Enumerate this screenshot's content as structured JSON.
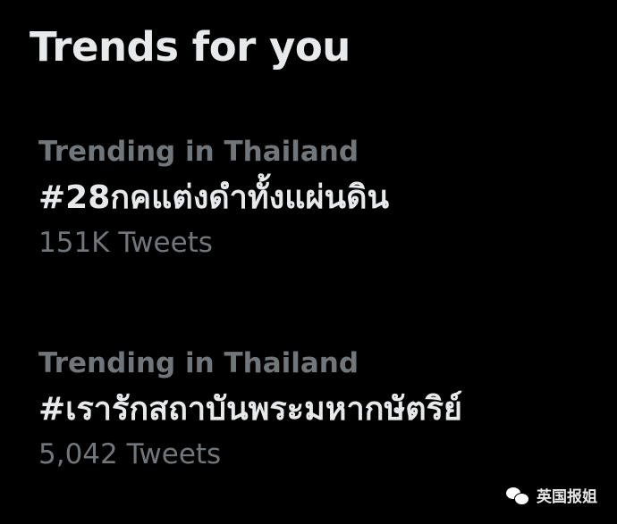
{
  "section": {
    "title": "Trends for you"
  },
  "trends": [
    {
      "context": "Trending in Thailand",
      "hashtag": "#28กคแต่งดำทั้งแผ่นดิน",
      "tweet_count": "151K Tweets"
    },
    {
      "context": "Trending in Thailand",
      "hashtag": "#เรารักสถาบันพระมหากษัตริย์",
      "tweet_count": "5,042 Tweets"
    }
  ],
  "watermark": {
    "icon": "wechat-icon",
    "label": "英国报姐"
  },
  "colors": {
    "background": "#000000",
    "primary_text": "#e7e9ea",
    "secondary_text": "#71767b"
  }
}
